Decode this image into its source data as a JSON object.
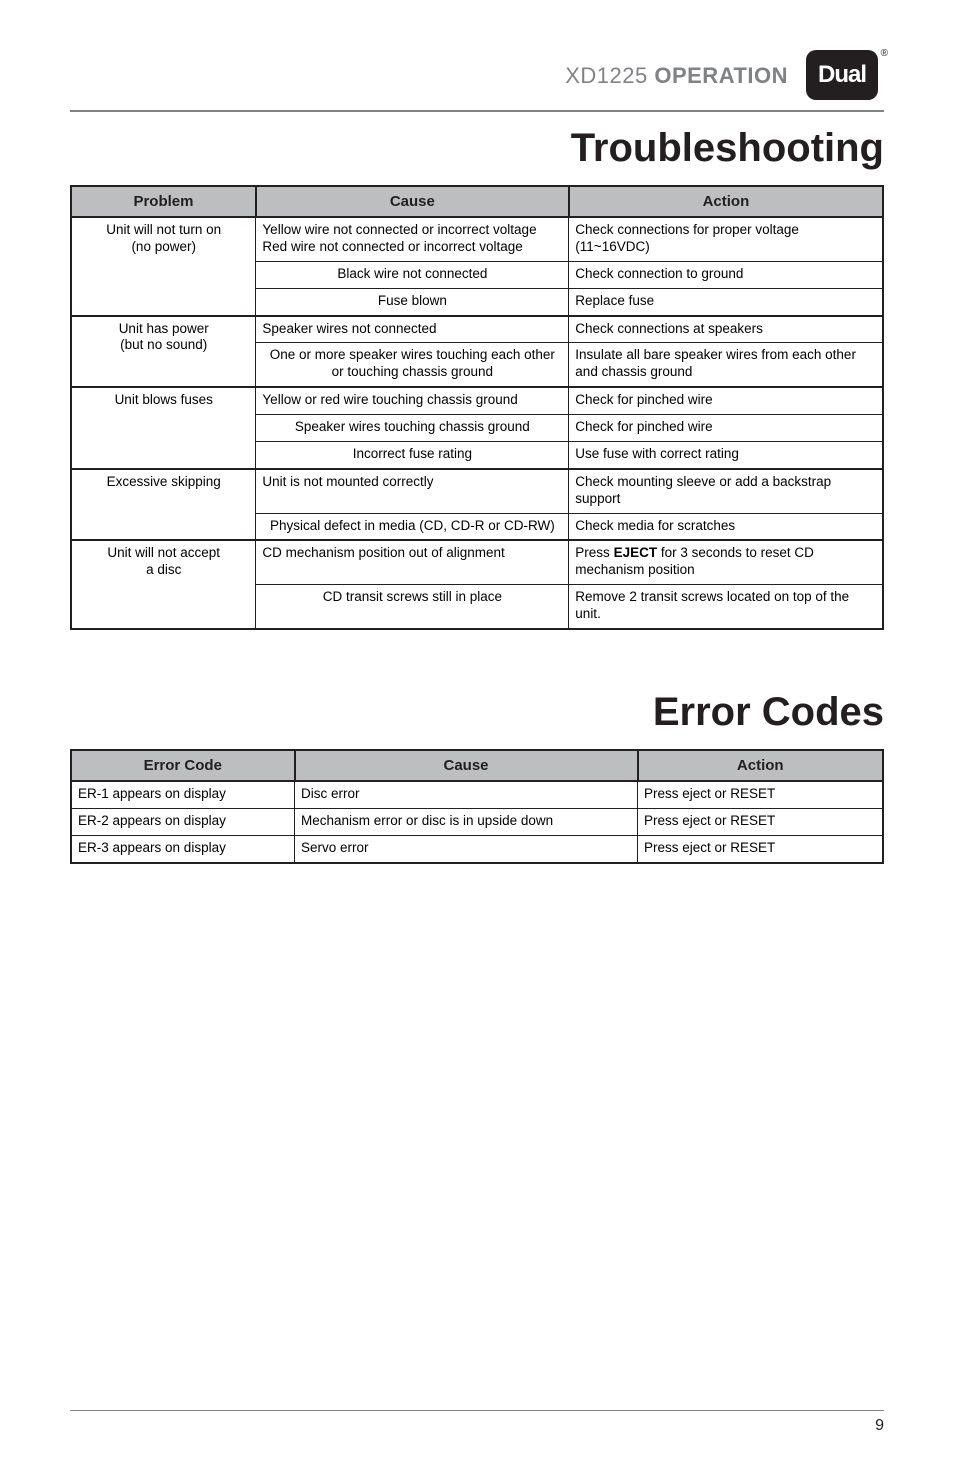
{
  "header": {
    "model": "XD1225",
    "operation": "OPERATION",
    "logo_text": "Dual",
    "reg": "®"
  },
  "troubleshooting": {
    "title": "Troubleshooting",
    "columns": [
      "Problem",
      "Cause",
      "Action"
    ],
    "groups": [
      {
        "problem_lines": [
          "Unit will not turn on",
          "(no power)"
        ],
        "rows": [
          {
            "cause": "Yellow wire not connected or incorrect voltage Red wire not connected or incorrect voltage",
            "action": "Check connections for proper voltage (11~16VDC)"
          },
          {
            "cause": "Black wire not connected",
            "action": "Check connection to ground"
          },
          {
            "cause": "Fuse blown",
            "action": "Replace fuse"
          }
        ]
      },
      {
        "problem_lines": [
          "Unit has power",
          "(but no sound)"
        ],
        "rows": [
          {
            "cause": "Speaker wires not connected",
            "action": "Check connections at speakers"
          },
          {
            "cause": "One or more speaker wires touching each other or touching chassis ground",
            "action": "Insulate all bare speaker wires from each other and chassis ground"
          }
        ]
      },
      {
        "problem_lines": [
          "Unit blows fuses"
        ],
        "rows": [
          {
            "cause": "Yellow or red wire touching chassis ground",
            "action": "Check for pinched wire"
          },
          {
            "cause": "Speaker wires touching chassis ground",
            "action": "Check for pinched wire"
          },
          {
            "cause": "Incorrect fuse rating",
            "action": "Use fuse with correct rating"
          }
        ]
      },
      {
        "problem_lines": [
          "Excessive skipping"
        ],
        "rows": [
          {
            "cause": "Unit is not mounted correctly",
            "action": "Check mounting sleeve or add a backstrap support"
          },
          {
            "cause": "Physical defect in media (CD, CD-R or CD-RW)",
            "action": "Check media for scratches"
          }
        ]
      },
      {
        "problem_lines": [
          "Unit will not accept",
          "a disc"
        ],
        "rows": [
          {
            "cause": "CD mechanism position out of alignment",
            "action_prefix": "Press ",
            "action_bold": "EJECT",
            "action_suffix": " for 3 seconds to reset CD mechanism position"
          },
          {
            "cause": "CD transit screws still in place",
            "action": "Remove 2 transit screws located on top of the unit."
          }
        ]
      }
    ]
  },
  "error_codes": {
    "title": "Error Codes",
    "columns": [
      "Error Code",
      "Cause",
      "Action"
    ],
    "rows": [
      {
        "code": "ER-1 appears on display",
        "cause": "Disc error",
        "action": "Press eject or RESET"
      },
      {
        "code": "ER-2 appears on display",
        "cause": "Mechanism error or disc is in upside down",
        "action": "Press eject or RESET"
      },
      {
        "code": "ER-3 appears on display",
        "cause": "Servo error",
        "action": "Press eject or RESET"
      }
    ]
  },
  "page_number": "9"
}
